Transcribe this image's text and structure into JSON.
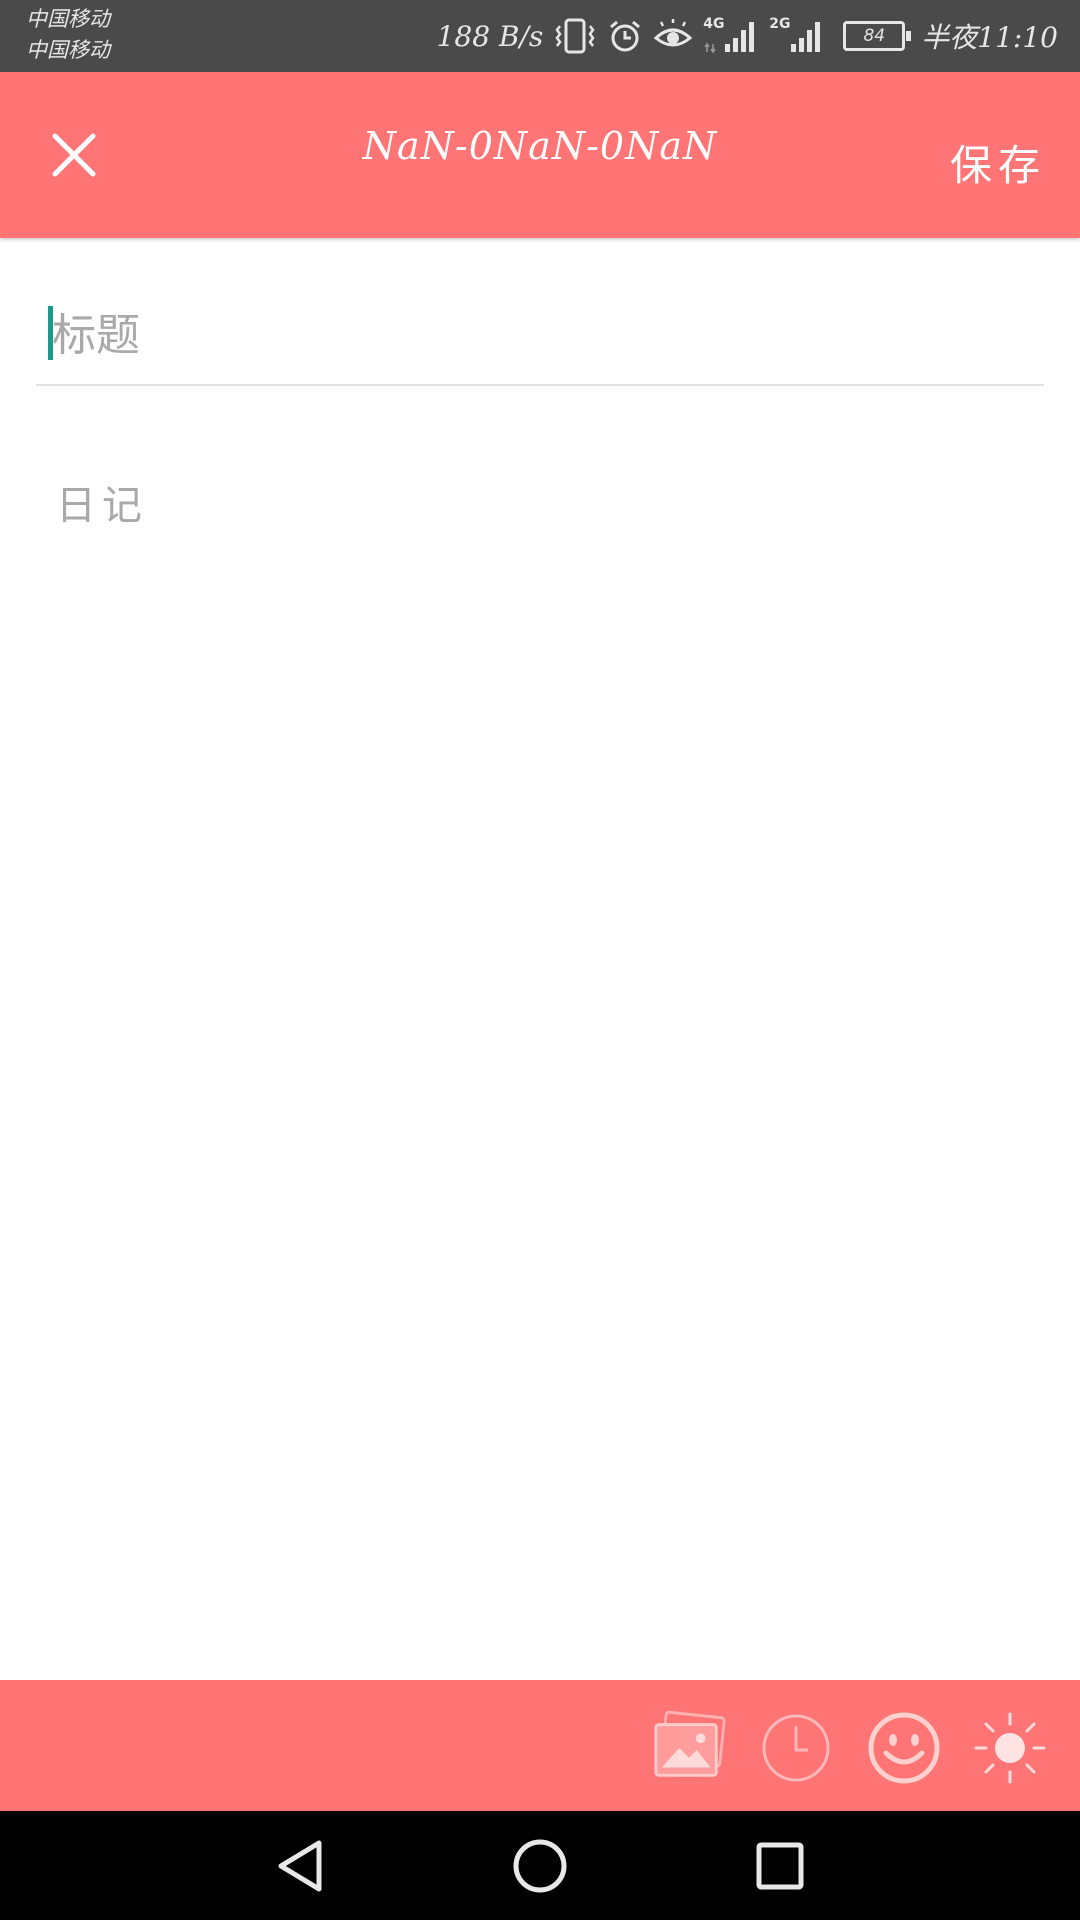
{
  "status_bar": {
    "carrier_1": "中国移动",
    "carrier_2": "中国移动",
    "net_speed": "188 B/s",
    "net_4g": "4G",
    "net_2g": "2G",
    "battery": "84",
    "time": "半夜11:10"
  },
  "header": {
    "title": "NaN-0NaN-0NaN",
    "save_label": "保存"
  },
  "editor": {
    "title_placeholder": "标题",
    "diary_placeholder": "日记"
  },
  "colors": {
    "primary": "#ff7474",
    "caret": "#1a9a8a",
    "status_bar": "#4a4a4a"
  },
  "toolbar": {
    "icons": [
      "image-icon",
      "clock-icon",
      "smiley-icon",
      "sun-icon"
    ]
  }
}
